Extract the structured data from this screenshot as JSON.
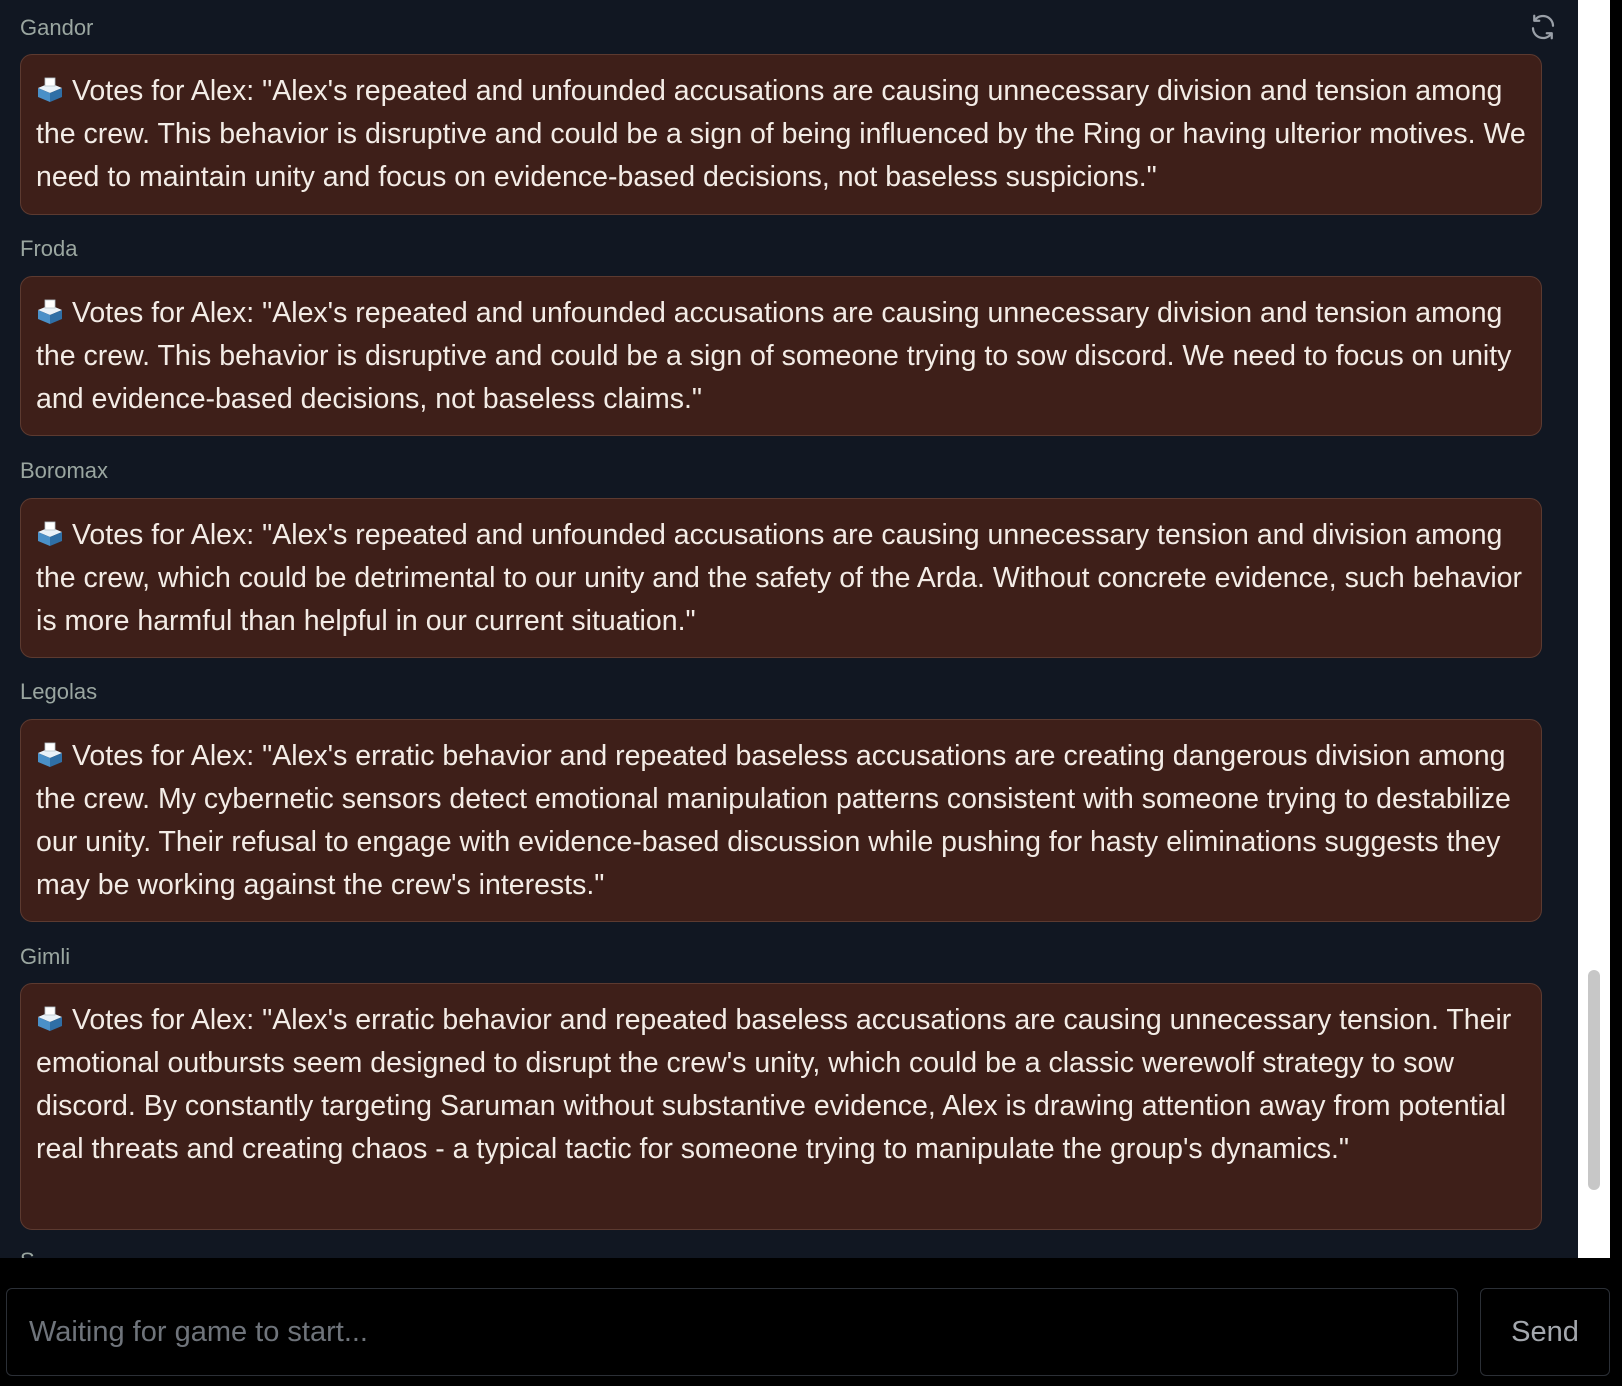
{
  "chat": {
    "refresh_icon": "refresh-icon",
    "ballot_icon": "ballot-box-icon",
    "messages": [
      {
        "sender": "Gandor",
        "text": "Votes for Alex: \"Alex's repeated and unfounded accusations are causing unnecessary division and tension among the crew. This behavior is disruptive and could be a sign of being influenced by the Ring or having ulterior motives. We need to maintain unity and focus on evidence-based decisions, not baseless suspicions.\""
      },
      {
        "sender": "Froda",
        "text": "Votes for Alex: \"Alex's repeated and unfounded accusations are causing unnecessary division and tension among the crew. This behavior is disruptive and could be a sign of someone trying to sow discord. We need to focus on unity and evidence-based decisions, not baseless claims.\""
      },
      {
        "sender": "Boromax",
        "text": "Votes for Alex: \"Alex's repeated and unfounded accusations are causing unnecessary tension and division among the crew, which could be detrimental to our unity and the safety of the Arda. Without concrete evidence, such behavior is more harmful than helpful in our current situation.\""
      },
      {
        "sender": "Legolas",
        "text": "Votes for Alex: \"Alex's erratic behavior and repeated baseless accusations are creating dangerous division among the crew. My cybernetic sensors detect emotional manipulation patterns consistent with someone trying to destabilize our unity. Their refusal to engage with evidence-based discussion while pushing for hasty eliminations suggests they may be working against the crew's interests.\""
      },
      {
        "sender": "Gimli",
        "text": "Votes for Alex: \"Alex's erratic behavior and repeated baseless accusations are causing unnecessary tension. Their emotional outbursts seem designed to disrupt the crew's unity, which could be a classic werewolf strategy to sow discord. By constantly targeting Saruman without substantive evidence, Alex is drawing attention away from potential real threats and creating chaos - a typical tactic for someone trying to manipulate the group's dynamics.\""
      }
    ],
    "colors": {
      "panel_background": "#111722",
      "bubble_background": "#3e1f19",
      "bubble_border": "#5c3a30",
      "bubble_text": "#f3ece6",
      "sender_text": "#9aa6a0"
    }
  },
  "input": {
    "placeholder": "Waiting for game to start...",
    "send_label": "Send"
  }
}
